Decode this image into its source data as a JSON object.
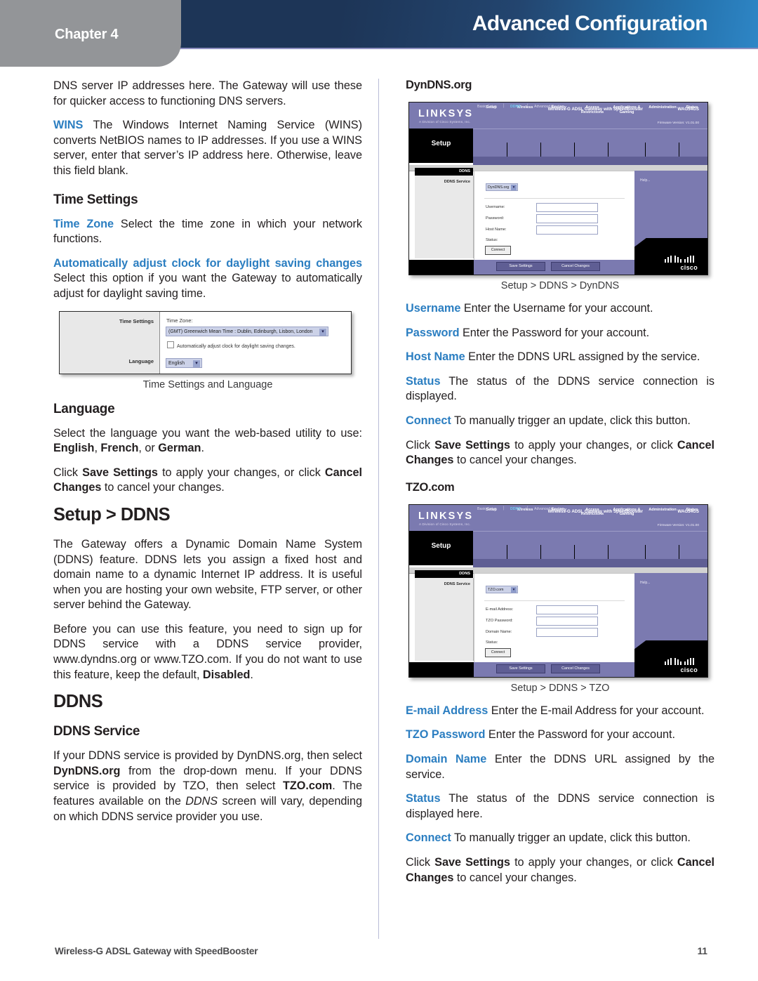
{
  "header": {
    "chapter_label": "Chapter 4",
    "title": "Advanced Configuration",
    "accent_dark": "#1d3557",
    "accent_light": "#2e86c6",
    "tab_color": "#939598"
  },
  "left_column": {
    "p_dns_cont": "DNS server IP addresses here. The Gateway will use these for quicker access to functioning DNS servers.",
    "wins_lead": "WINS",
    "wins_text": " The Windows Internet Naming Service (WINS) converts NetBIOS names to IP addresses. If you use a WINS server, enter that server’s IP address here. Otherwise, leave this field blank.",
    "h_time_settings": "Time Settings",
    "timezone_lead": "Time Zone",
    "timezone_text": "  Select the time zone in which your network functions.",
    "autoadjust_lead": "Automatically adjust clock for daylight saving changes",
    "autoadjust_text": " Select this option if you want the Gateway to automatically adjust for daylight saving time.",
    "fig_caption": "Time Settings and Language",
    "h_language": "Language",
    "language_p1_a": "Select the language you want the web-based utility to use: ",
    "language_p1_b_english": "English",
    "language_p1_c": ", ",
    "language_p1_d_french": "French",
    "language_p1_e": ", or ",
    "language_p1_f_german": "German",
    "language_p1_g": ".",
    "save_click": "Click ",
    "save_bold1": "Save Settings",
    "save_mid": " to apply your changes, or click ",
    "save_bold2": "Cancel Changes",
    "save_end": " to cancel your changes.",
    "h_setup_ddns": "Setup > DDNS",
    "ddns_p1": "The Gateway offers a Dynamic Domain Name System (DDNS) feature. DDNS lets you assign a fixed host and domain name to a dynamic Internet IP address. It is useful when you are hosting your own website, FTP server, or other server behind the Gateway.",
    "ddns_p2_a": "Before you can use this feature, you need to sign up for DDNS service with a DDNS service provider, www.dyndns.org or www.TZO.com. If you do not want to use this feature, keep the default, ",
    "ddns_p2_b_disabled": "Disabled",
    "ddns_p2_c": ".",
    "h_ddns": "DDNS",
    "h_ddns_service": "DDNS Service",
    "ddns_service_a": "If your DDNS service is provided by DynDNS.org, then select ",
    "ddns_service_b": "DynDNS.org",
    "ddns_service_c": " from the drop-down menu. If your DDNS service is provided by TZO, then select ",
    "ddns_service_d": "TZO.com",
    "ddns_service_e": ". The features available on the ",
    "ddns_service_f_italic": "DDNS",
    "ddns_service_g": " screen will vary, depending on which DDNS service provider you use."
  },
  "right_column": {
    "h_dyndns": "DynDNS.org",
    "fig1_caption": "Setup > DDNS > DynDNS",
    "username_lead": "Username",
    "username_text": "  Enter the Username for your account.",
    "password_lead": "Password",
    "password_text": "  Enter the Password for your account.",
    "hostname_lead": "Host Name",
    "hostname_text": "  Enter the DDNS URL assigned by the service.",
    "status_lead": "Status",
    "status_text": " The status of the DDNS service connection is displayed.",
    "connect_lead": "Connect",
    "connect_text": " To manually trigger an update, click this button.",
    "save_click": "Click ",
    "save_bold1": "Save Settings",
    "save_mid": " to apply your changes, or click ",
    "save_bold2": "Cancel Changes",
    "save_end": " to cancel your changes.",
    "h_tzo": "TZO.com",
    "fig2_caption": "Setup > DDNS > TZO",
    "email_lead": "E-mail Address",
    "email_text": " Enter the E-mail Address for your account.",
    "tzopw_lead": "TZO Password",
    "tzopw_text": "  Enter the Password for your account.",
    "domain_lead": "Domain Name",
    "domain_text": " Enter the DDNS URL assigned by the service.",
    "status2_lead": "Status",
    "status2_text": " The status of the DDNS service connection is displayed here.",
    "connect2_lead": "Connect",
    "connect2_text": " To manually trigger an update, click this button.",
    "save2_click": "Click ",
    "save2_bold1": "Save Settings",
    "save2_mid": " to apply your changes, or click ",
    "save2_bold2": "Cancel Changes",
    "save2_end": " to cancel your changes."
  },
  "fig_time_settings": {
    "label_time_settings": "Time Settings",
    "label_language": "Language",
    "field_title": "Time Zone:",
    "timezone_value": "(GMT) Greenwich Mean Time : Dublin, Edinburgh, Lisbon, London",
    "checkbox_label": "Automatically adjust clock for daylight saving changes.",
    "language_value": "English",
    "dropdown_arrow": "▾"
  },
  "fig_dyndns": {
    "brand": "LINKSYS",
    "brand_sub": "A Division of Cisco Systems, Inc.",
    "firmware": "Firmware Version: V1.01.00",
    "section_word": "Setup",
    "model_title": "Wireless-G ADSL Gateway with SpeedBooster",
    "model_number": "WAG54GS",
    "tabs": [
      "Setup",
      "Wireless",
      "Security",
      "Access Restrictions",
      "Applications & Gaming",
      "Administration",
      "Status"
    ],
    "subtabs": [
      "Basic Setup",
      "DDNS",
      "Advanced Routing"
    ],
    "side_header": "DDNS",
    "side_label": "DDNS Service",
    "service_value": "DynDNS.org",
    "fields": [
      "Username:",
      "Password:",
      "Host Name:"
    ],
    "status_label": "Status:",
    "connect_button": "Connect",
    "save_button": "Save  Settings",
    "cancel_button": "Cancel Changes",
    "help_label": "Help...",
    "cisco_text": "cisco",
    "dropdown_arrow": "▾"
  },
  "fig_tzo": {
    "brand": "LINKSYS",
    "brand_sub": "A Division of Cisco Systems, Inc.",
    "firmware": "Firmware Version: V1.01.00",
    "section_word": "Setup",
    "model_title": "Wireless-G ADSL Gateway with SpeedBooster",
    "model_number": "WAG54GS",
    "tabs": [
      "Setup",
      "Wireless",
      "Security",
      "Access Restrictions",
      "Applications & Gaming",
      "Administration",
      "Status"
    ],
    "subtabs": [
      "Basic Setup",
      "DDNS",
      "Advanced Routing"
    ],
    "side_header": "DDNS",
    "side_label": "DDNS Service",
    "service_value": "TZO.com",
    "fields": [
      "E-mail Address:",
      "TZO Password:",
      "Domain Name:"
    ],
    "status_label": "Status:",
    "connect_button": "Connect",
    "save_button": "Save  Settings",
    "cancel_button": "Cancel Changes",
    "help_label": "Help...",
    "cisco_text": "cisco",
    "dropdown_arrow": "▾"
  },
  "footer": {
    "left": "Wireless-G ADSL Gateway with SpeedBooster",
    "page": "11"
  }
}
